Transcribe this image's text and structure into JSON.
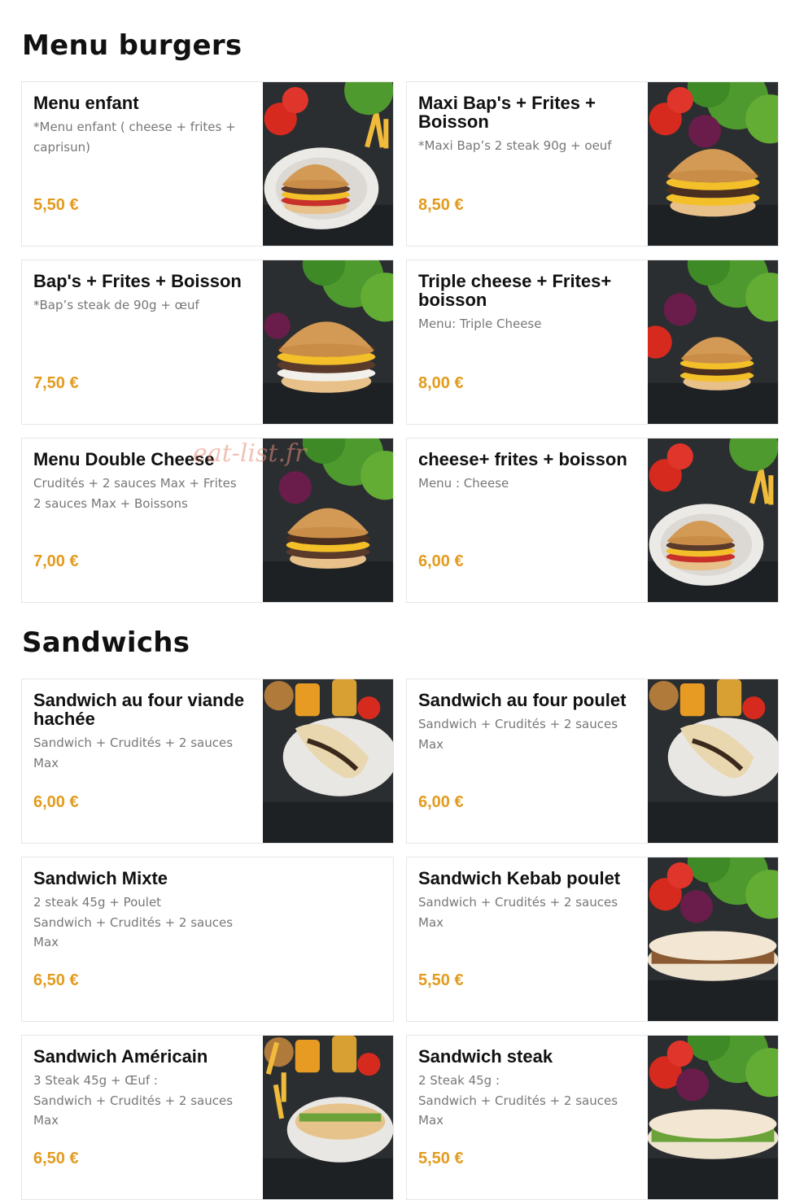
{
  "watermark": "eat-list.fr",
  "colors": {
    "price": "#e39b1e",
    "title": "#111111",
    "description": "#777777",
    "border": "#e6e6e6"
  },
  "sections": [
    {
      "title": "Menu burgers",
      "items": [
        {
          "name": "Menu enfant",
          "description": "*Menu enfant ( cheese + frites +\ncaprisun)",
          "price": "5,50 €",
          "image": "kids-burger-plate-photo"
        },
        {
          "name": "Maxi Bap's + Frites +\nBoisson",
          "description": "*Maxi Bap’s 2 steak 90g + oeuf",
          "price": "8,50 €",
          "image": "double-burger-photo"
        },
        {
          "name": "Bap's + Frites + Boisson",
          "description": "*Bap’s steak de 90g + œuf",
          "price": "7,50 €",
          "image": "egg-burger-photo"
        },
        {
          "name": "Triple cheese + Frites+\nboisson",
          "description": "Menu: Triple Cheese",
          "price": "8,00 €",
          "image": "triple-cheese-burger-photo"
        },
        {
          "name": "Menu Double Cheese",
          "description": "Crudités + 2 sauces Max + Frites\n2 sauces Max + Boissons",
          "price": "7,00 €",
          "image": "double-cheese-burger-photo"
        },
        {
          "name": "cheese+ frites + boisson",
          "description": "Menu : Cheese",
          "price": "6,00 €",
          "image": "cheeseburger-plate-photo"
        }
      ]
    },
    {
      "title": "Sandwichs",
      "items": [
        {
          "name": "Sandwich au four viande\nhachée",
          "description": "Sandwich + Crudités + 2 sauces\nMax",
          "price": "6,00 €",
          "image": "oven-sandwich-photo"
        },
        {
          "name": "Sandwich au four poulet",
          "description": "Sandwich + Crudités + 2 sauces\nMax",
          "price": "6,00 €",
          "image": "oven-sandwich-chicken-photo"
        },
        {
          "name": "Sandwich Mixte",
          "description": "2 steak 45g + Poulet\nSandwich + Crudités + 2 sauces\nMax",
          "price": "6,50 €",
          "image": ""
        },
        {
          "name": "Sandwich Kebab poulet",
          "description": "Sandwich + Crudités + 2 sauces\nMax",
          "price": "5,50 €",
          "image": "kebab-sandwich-photo"
        },
        {
          "name": "Sandwich Américain",
          "description": "3 Steak 45g + Œuf :\nSandwich + Crudités + 2 sauces\nMax",
          "price": "6,50 €",
          "image": "american-sandwich-photo"
        },
        {
          "name": "Sandwich steak",
          "description": "2 Steak 45g :\nSandwich + Crudités + 2 sauces\nMax",
          "price": "5,50 €",
          "image": "steak-sandwich-photo"
        }
      ]
    }
  ]
}
